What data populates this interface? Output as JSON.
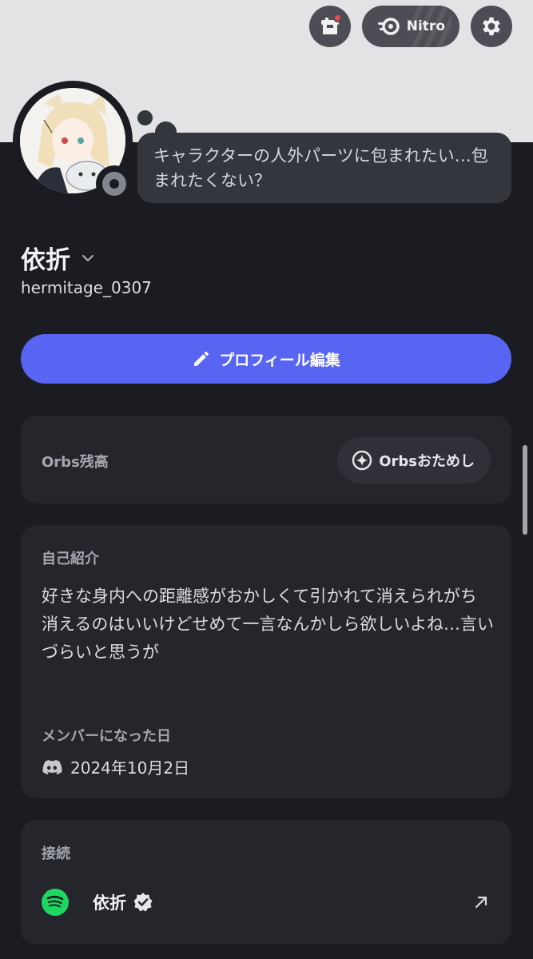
{
  "header": {
    "nitro_label": "Nitro",
    "icons": {
      "shop": "shop-icon",
      "nitro": "nitro-icon",
      "settings": "gear-icon"
    },
    "notification_color": "#e5484d"
  },
  "profile": {
    "status_message": "キャラクターの人外パーツに包まれたい…包まれたくない？",
    "display_name": "依折",
    "username": "hermitage_0307",
    "presence": "offline"
  },
  "edit_profile": {
    "label": "プロフィール編集",
    "icon": "pencil-icon",
    "color": "#5865f2"
  },
  "orbs": {
    "label": "Orbs残高",
    "button_label": "Orbsおためし",
    "icon": "orbs-icon"
  },
  "about": {
    "label": "自己紹介",
    "bio_line1": "好きな身内への距離感がおかしくて引かれて消えられがち",
    "bio_line2": "消えるのはいいけどせめて一言なんかしら欲しいよね…言いづらいと思うが",
    "member_since_label": "メンバーになった日",
    "member_since": "2024年10月2日",
    "member_icon": "discord-icon"
  },
  "connections": {
    "label": "接続",
    "items": [
      {
        "service_icon": "spotify-icon",
        "name": "依折",
        "verified": true,
        "link_icon": "external-link-icon"
      }
    ]
  }
}
